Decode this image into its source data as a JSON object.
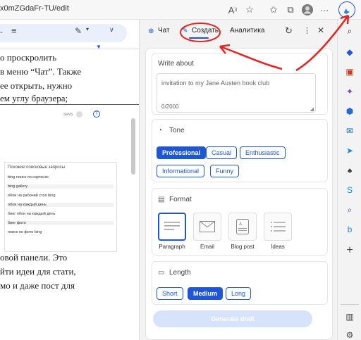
{
  "browser": {
    "url": "x0mZGdaFr-TU/edit"
  },
  "document": {
    "lines_top": [
      "о проскролить",
      "в меню “Чат”. Также",
      "ее открыть, нужно",
      "ем углу браузера;"
    ],
    "lines_bottom": [
      "овой панели. Это",
      "йти идеи для стати,",
      "мо и даже пост для"
    ],
    "embed": {
      "title": "Похожие поисковые запросы",
      "items": [
        "bing поиск по картинке",
        "bing gallery",
        "обои на рабочий стол bing",
        "обои на каждый день",
        "бинг обои на каждый день",
        "бинг фото",
        "поиск по фото bing"
      ]
    }
  },
  "copilot": {
    "tabs": {
      "chat": "Чат",
      "compose": "Создать",
      "insights": "Аналитика"
    },
    "write_about": {
      "title": "Write about",
      "value": "invitation to my Jane Austen book club",
      "counter": "0/2000"
    },
    "tone": {
      "title": "Tone",
      "options": [
        "Professional",
        "Casual",
        "Enthusiastic",
        "Informational",
        "Funny"
      ],
      "selected": "Professional"
    },
    "format": {
      "title": "Format",
      "options": [
        "Paragraph",
        "Email",
        "Blog post",
        "Ideas"
      ],
      "selected": "Paragraph"
    },
    "length": {
      "title": "Length",
      "options": [
        "Short",
        "Medium",
        "Long"
      ],
      "selected": "Medium"
    },
    "generate_label": "Generate draft"
  },
  "colors": {
    "accent": "#1f56d6",
    "annotation": "#e8231f"
  }
}
